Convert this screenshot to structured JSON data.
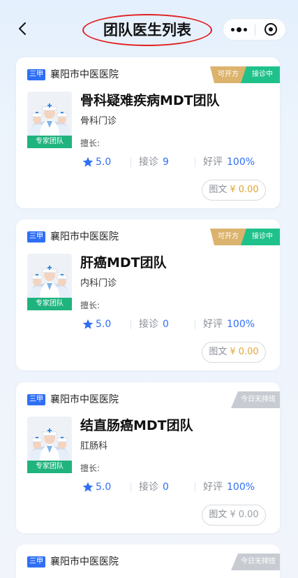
{
  "nav": {
    "title": "团队医生列表",
    "back_icon": "chevron-left-icon",
    "more_icon": "more-dots-icon",
    "close_icon": "target-circle-icon"
  },
  "colors": {
    "accent_blue": "#2f6ff5",
    "team_green": "#1fb37e",
    "open_green": "#1fc18a",
    "rx_gold": "#dcb36d",
    "off_gray": "#c8ccd2",
    "price_orange": "#e3a53a",
    "title_circle_red": "#e02020"
  },
  "cards": [
    {
      "level": "三甲",
      "hospital": "襄阳市中医医院",
      "tag_rx": "可开方",
      "tag_status": "接诊中",
      "team_tag": "专家团队",
      "name": "骨科疑难疾病MDT团队",
      "dept": "骨科门诊",
      "skill": "擅长:",
      "rating": "5.0",
      "visits_label": "接诊",
      "visits": "9",
      "praise_label": "好评",
      "praise": "100%",
      "consult_type": "图文",
      "price": "¥ 0.00"
    },
    {
      "level": "三甲",
      "hospital": "襄阳市中医医院",
      "tag_rx": "可开方",
      "tag_status": "接诊中",
      "team_tag": "专家团队",
      "name": "肝癌MDT团队",
      "dept": "内科门诊",
      "skill": "擅长:",
      "rating": "5.0",
      "visits_label": "接诊",
      "visits": "0",
      "praise_label": "好评",
      "praise": "100%",
      "consult_type": "图文",
      "price": "¥ 0.00"
    },
    {
      "level": "三甲",
      "hospital": "襄阳市中医医院",
      "tag_status": "今日无排班",
      "team_tag": "专家团队",
      "name": "结直肠癌MDT团队",
      "dept": "肛肠科",
      "skill": "擅长:",
      "rating": "5.0",
      "visits_label": "接诊",
      "visits": "0",
      "praise_label": "好评",
      "praise": "100%",
      "consult_type": "图文",
      "price": "¥ 0.00"
    },
    {
      "level": "三甲",
      "hospital": "襄阳市中医医院",
      "tag_status": "今日无排班"
    }
  ]
}
